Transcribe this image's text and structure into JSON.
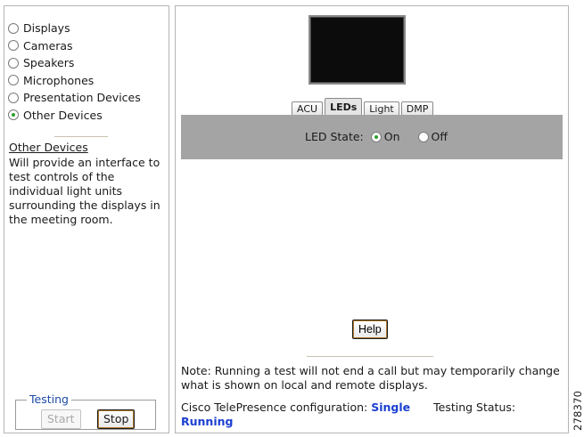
{
  "device_list": [
    {
      "label": "Displays",
      "selected": false
    },
    {
      "label": "Cameras",
      "selected": false
    },
    {
      "label": "Speakers",
      "selected": false
    },
    {
      "label": "Microphones",
      "selected": false
    },
    {
      "label": "Presentation Devices",
      "selected": false
    },
    {
      "label": "Other Devices",
      "selected": true
    }
  ],
  "description": {
    "title": "Other Devices",
    "body": "Will provide an interface to test controls of the individual light units surrounding the displays in the meeting room."
  },
  "testing": {
    "legend": "Testing",
    "start_label": "Start",
    "stop_label": "Stop"
  },
  "tabs": [
    {
      "label": "ACU",
      "active": false
    },
    {
      "label": "LEDs",
      "active": true
    },
    {
      "label": "Light",
      "active": false
    },
    {
      "label": "DMP",
      "active": false
    }
  ],
  "led_state": {
    "label": "LED State:",
    "on_label": "On",
    "off_label": "Off",
    "selected": "On"
  },
  "help_label": "Help",
  "note": "Note: Running a test will not end a call but may temporarily change what is shown on local and remote displays.",
  "status": {
    "config_label": "Cisco TelePresence configuration:",
    "config_value": "Single",
    "testing_label": "Testing Status:",
    "testing_value": "Running"
  },
  "figure_id": "278370",
  "colors": {
    "accent_blue": "#1a3fd1",
    "radio_selected": "#2e9e2e",
    "panel_gray": "#a4a4a4"
  }
}
